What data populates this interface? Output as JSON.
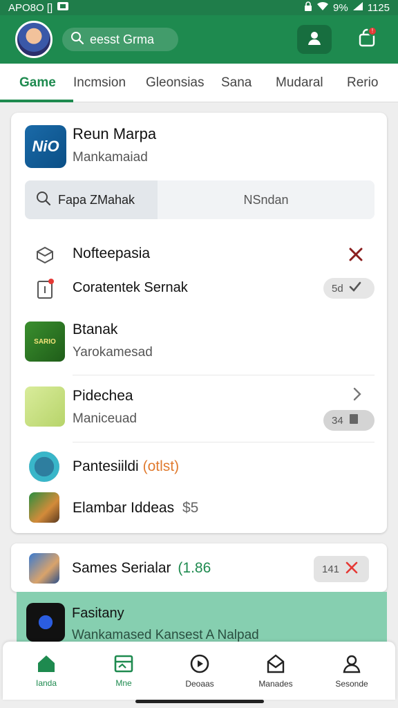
{
  "status_bar": {
    "left_text": "APO8O [] ",
    "right_text": "9% ",
    "time": "1125"
  },
  "header": {
    "search_text": "eesst Grma"
  },
  "tabs": [
    {
      "label": "Game"
    },
    {
      "label": "Incmsion"
    },
    {
      "label": "Gleonsias"
    },
    {
      "label": "Sana"
    },
    {
      "label": "Mudaral"
    },
    {
      "label": "Rerio"
    }
  ],
  "hero": {
    "icon_text": "NiO",
    "title": "Reun Marpa",
    "subtitle": "Mankamaiad"
  },
  "segment": {
    "left_label": "Fapa ZMahak",
    "right_label": "NSndan"
  },
  "rows": [
    {
      "title": "Nofteepasia"
    },
    {
      "title": "Coratentek Sernak",
      "chip": "5d"
    },
    {
      "title": "Btanak",
      "subtitle": "Yarokamesad",
      "thumb_text": "SARIO"
    },
    {
      "title": "Pidechea",
      "subtitle": "Maniceuad",
      "chip": "34"
    },
    {
      "title": "Pantesiildi",
      "paren": "(otlst)"
    },
    {
      "title": "Elambar Iddeas",
      "extra": "$5"
    }
  ],
  "card2": {
    "title": "Sames Serialar",
    "paren": "(1.86",
    "chip": "141"
  },
  "banner": {
    "title": "Fasitany",
    "subtitle": "Wankamased Kansest A Nalpad"
  },
  "bottom_nav": [
    {
      "label": "Ianda"
    },
    {
      "label": "Mne"
    },
    {
      "label": "Deoaas"
    },
    {
      "label": "Manades"
    },
    {
      "label": "Sesonde"
    }
  ],
  "colors": {
    "brand_green": "#1e8a4f",
    "banner_green": "#86cfb0",
    "danger": "#e53935"
  }
}
